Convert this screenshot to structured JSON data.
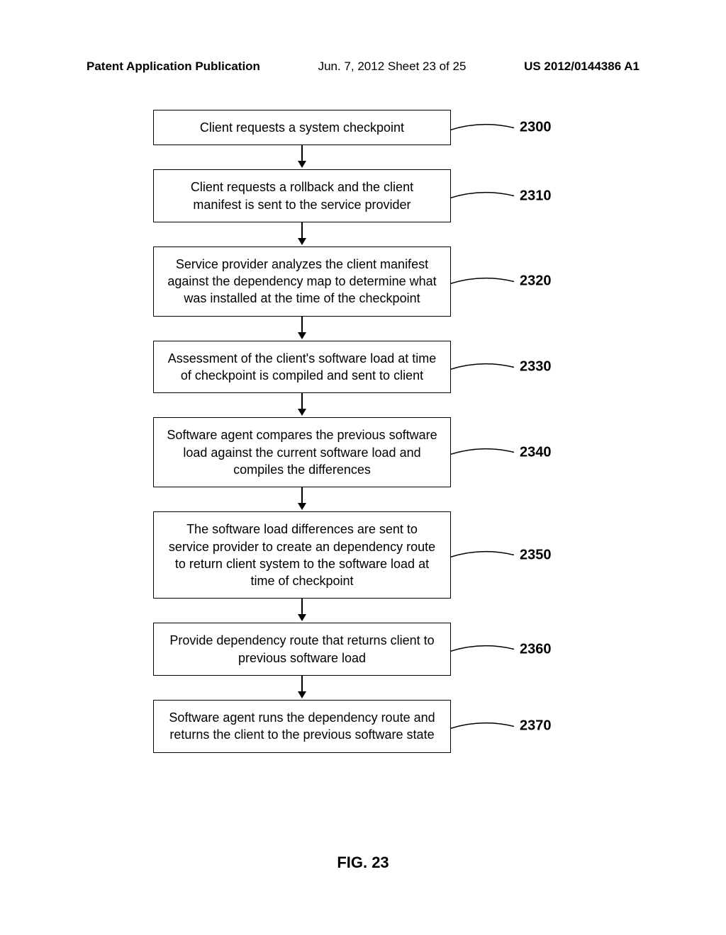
{
  "header": {
    "left": "Patent Application Publication",
    "center": "Jun. 7, 2012  Sheet 23 of 25",
    "right": "US 2012/0144386 A1"
  },
  "flowchart": {
    "steps": [
      {
        "ref": "2300",
        "text": "Client requests a system checkpoint"
      },
      {
        "ref": "2310",
        "text": "Client requests a rollback and the client manifest is sent to the service provider"
      },
      {
        "ref": "2320",
        "text": "Service provider analyzes the client manifest against the dependency map to determine what was installed at the time of the checkpoint"
      },
      {
        "ref": "2330",
        "text": "Assessment of the client's software load at time of checkpoint is compiled and sent to client"
      },
      {
        "ref": "2340",
        "text": "Software agent compares the previous software load against the current software load and compiles the differences"
      },
      {
        "ref": "2350",
        "text": "The software load differences are sent to service provider to create an dependency route to return client system to the software load at time of checkpoint"
      },
      {
        "ref": "2360",
        "text": "Provide dependency route that returns client to previous software load"
      },
      {
        "ref": "2370",
        "text": "Software agent runs the dependency route and returns the client to the previous software state"
      }
    ]
  },
  "figure_label": "FIG. 23",
  "chart_data": {
    "type": "flowchart",
    "title": "FIG. 23",
    "direction": "top-to-bottom",
    "nodes": [
      {
        "id": "2300",
        "label": "Client requests a system checkpoint"
      },
      {
        "id": "2310",
        "label": "Client requests a rollback and the client manifest is sent to the service provider"
      },
      {
        "id": "2320",
        "label": "Service provider analyzes the client manifest against the dependency map to determine what was installed at the time of the checkpoint"
      },
      {
        "id": "2330",
        "label": "Assessment of the client's software load at time of checkpoint is compiled and sent to client"
      },
      {
        "id": "2340",
        "label": "Software agent compares the previous software load against the current software load and compiles the differences"
      },
      {
        "id": "2350",
        "label": "The software load differences are sent to service provider to create an dependency route to return client system to the software load at time of checkpoint"
      },
      {
        "id": "2360",
        "label": "Provide dependency route that returns client to previous software load"
      },
      {
        "id": "2370",
        "label": "Software agent runs the dependency route and returns the client to the previous software state"
      }
    ],
    "edges": [
      {
        "from": "2300",
        "to": "2310"
      },
      {
        "from": "2310",
        "to": "2320"
      },
      {
        "from": "2320",
        "to": "2330"
      },
      {
        "from": "2330",
        "to": "2340"
      },
      {
        "from": "2340",
        "to": "2350"
      },
      {
        "from": "2350",
        "to": "2360"
      },
      {
        "from": "2360",
        "to": "2370"
      }
    ]
  }
}
